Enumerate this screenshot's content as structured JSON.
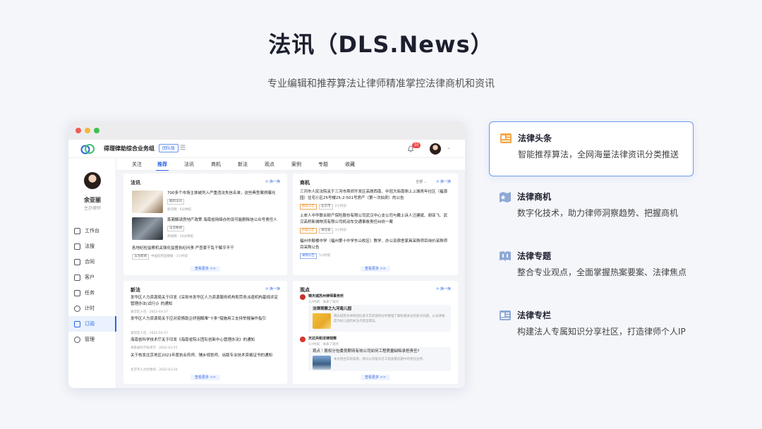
{
  "hero": {
    "title": "法讯（DLS.News）",
    "subtitle": "专业编辑和推荐算法让律师精准掌控法律商机和资讯"
  },
  "app": {
    "org_name": "得理律助综合业务组",
    "team_badge": "团队版",
    "notification_count": "10",
    "user": {
      "name": "余亚丽",
      "role": "主办律师"
    },
    "sidebar": [
      {
        "label": "工作台",
        "icon": "monitor-icon"
      },
      {
        "label": "法搜",
        "icon": "search-doc-icon"
      },
      {
        "label": "合同",
        "icon": "contract-icon"
      },
      {
        "label": "客户",
        "icon": "customer-icon"
      },
      {
        "label": "任务",
        "icon": "task-icon"
      },
      {
        "label": "计时",
        "icon": "clock-icon"
      },
      {
        "label": "订阅",
        "icon": "bookmark-icon",
        "active": true
      },
      {
        "label": "管理",
        "icon": "admin-icon"
      }
    ],
    "tabs": [
      "关注",
      "推荐",
      "法讯",
      "商机",
      "新法",
      "观点",
      "案例",
      "专题",
      "收藏"
    ],
    "active_tab": "推荐",
    "cards": {
      "faxun": {
        "title": "法讯",
        "refresh": "换一换",
        "items": [
          {
            "text": "700多个市场主体被列入严重违法失信名单，这些典型案例曝光",
            "tag": "最新法讯",
            "meta": "新华网 · 6分钟前"
          },
          {
            "text": "蒸蔺解读房地产政策 海南省网络办的设可能删除信公众号责任人",
            "tag": "法治要闻",
            "meta": "央视网 · 16分钟前"
          },
          {
            "text": "各地纪检监察机关强化监督执纪问责 严查套干乱干解乎不干",
            "tag": "法治新闻",
            "meta": "中国纪检监察报 · 1小时前"
          }
        ],
        "more": "查看更多 >>"
      },
      "shangji": {
        "title": "商机",
        "filter": "全部",
        "refresh": "换一换",
        "items": [
          {
            "text": "三河市人民法院关于三河市燕郊开发区高晟西南、中冠大街南侧上上城青年社区（福源园）住宅小区25号楼25-2-501号房产（第一次拍卖）的公告",
            "tags": [
              "拍卖公告",
              "北京市"
            ],
            "meta": "2小时前"
          },
          {
            "text": "上岸人中华联合财产保险股份有限公司武汉中心支公司与戴上诉人汪建斌、胡亚飞、武汉高桥新城物流有限公司机动车交通事故责任纠纷一案",
            "tags": [
              "开庭公告",
              "湖北省"
            ],
            "meta": "3小时前"
          },
          {
            "text": "福州市鼓楼中学（福州第十中学东山校区）教学、办公及宿舍家具采购项目询价采购项目采购公告",
            "tags": [
              "采购公告"
            ],
            "meta": "5小时前"
          }
        ],
        "more": "查看更多 >>"
      },
      "xinfa": {
        "title": "新法",
        "refresh": "换一换",
        "items": [
          {
            "text": "发华区人力资源局关于印发《深圳市发华区人力资源服务机构和劳务派遣机构基规评定管理办法(试行)》的通知",
            "meta": "发华区人社 · 2022-03-27"
          },
          {
            "text": "发华区人力资源局关于应对疫情助企纾困解难\"十条\"措施用工支持举报操作指引",
            "meta": "发华区人社 · 2022-03-27"
          },
          {
            "text": "海南省科学技术厅关于印发《海南省院士团队创新中心管理办法》的通知",
            "meta": "海南省科学技术厅 · 2022-03-25"
          },
          {
            "text": "关于核发北京地区2021年度执业药师、辅乡规划师、出版专业技术资格证书的通知",
            "meta": "北京市人力社保局 · 2022-03-20"
          }
        ],
        "more": "查看更多 >>"
      },
      "guandian": {
        "title": "观点",
        "refresh": "换一换",
        "items": [
          {
            "source": "锦天城苏州律师事务所",
            "source_meta": "3小时前 · 发表了观点",
            "title": "法律观察之九河南儿园",
            "summary": "锦天城苏州律师团队基于实际案例分析整理了解析最关注的焦点问题，从法律角度为幼儿园的关注点提出建议。"
          },
          {
            "source": "天达共和法律观察",
            "source_meta": "5小时前 · 发表了观点",
            "title": "观点｜股权分包委员期待有效公司如何工程质量缺陷承担责任?",
            "summary": "本文结合实际案例，探讨公司股东在工程质量问题中的责任边界。"
          }
        ],
        "more": "查看更多 >>"
      }
    }
  },
  "features": [
    {
      "title": "法律头条",
      "desc": "智能推荐算法，全网海量法律资讯分类推送",
      "icon": "news-icon",
      "active": true
    },
    {
      "title": "法律商机",
      "desc": "数字化技术，助力律师洞察趋势、把握商机",
      "icon": "star-chart-icon"
    },
    {
      "title": "法律专题",
      "desc": "整合专业观点，全面掌握热案要案、法律焦点",
      "icon": "book-icon"
    },
    {
      "title": "法律专栏",
      "desc": "构建法人专属知识分享社区，打造律师个人IP",
      "icon": "column-icon"
    }
  ]
}
